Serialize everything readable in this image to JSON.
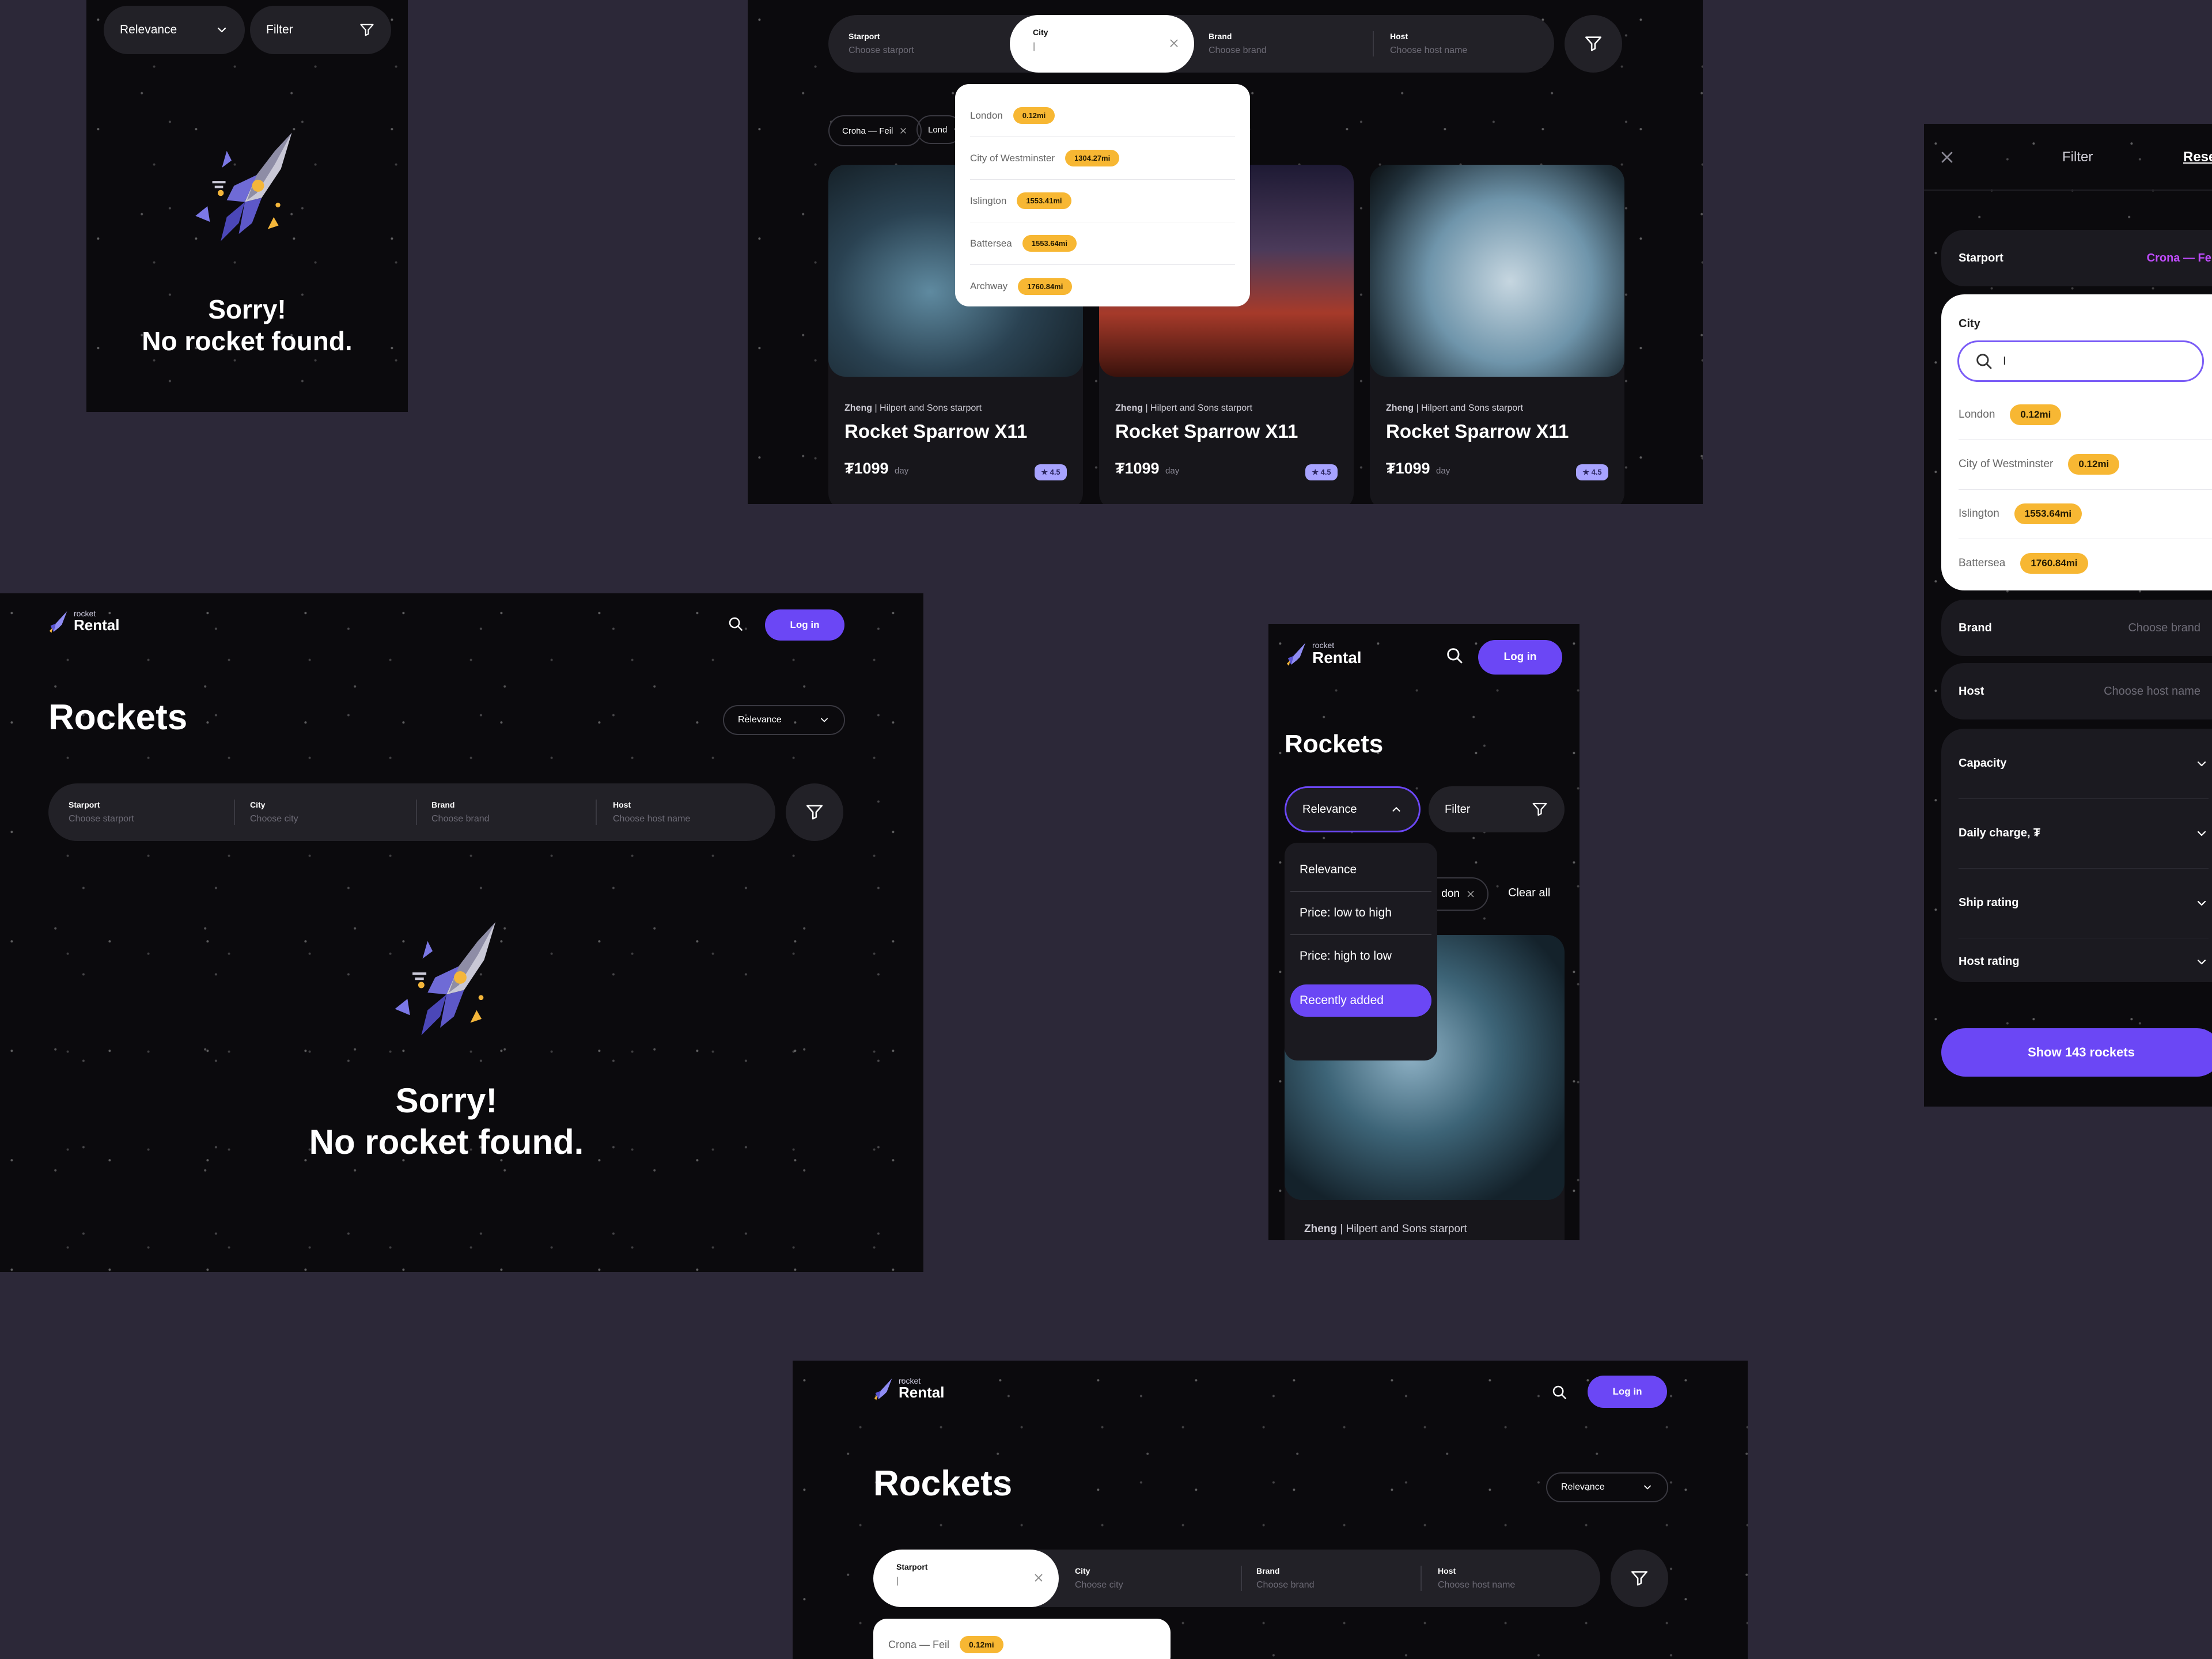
{
  "brand": {
    "small": "rocket",
    "big": "Rental"
  },
  "nav": {
    "login_label": "Log in"
  },
  "page": {
    "title": "Rockets"
  },
  "sort": {
    "selected": "Relevance",
    "options": [
      "Relevance",
      "Price: low to high",
      "Price: high to low",
      "Recently added"
    ],
    "active_option": "Recently added"
  },
  "filter_button": {
    "label": "Filter"
  },
  "search": {
    "starport_label": "Starport",
    "starport_placeholder": "Choose starport",
    "city_label": "City",
    "city_placeholder": "Choose city",
    "city_value": "|",
    "brand_label": "Brand",
    "brand_placeholder": "Choose brand",
    "host_label": "Host",
    "host_placeholder": "Choose host name"
  },
  "empty_state": {
    "line1": "Sorry!",
    "line2": "No rocket found."
  },
  "chips": {
    "starport": "Crona — Feil",
    "city_partial": "Lond",
    "city_partial2": "don",
    "clear_all": "Clear all"
  },
  "city_results_a": [
    {
      "name": "London",
      "distance": "0.12mi"
    },
    {
      "name": "City of Westminster",
      "distance": "1304.27mi"
    },
    {
      "name": "Islington",
      "distance": "1553.41mi"
    },
    {
      "name": "Battersea",
      "distance": "1553.64mi"
    },
    {
      "name": "Archway",
      "distance": "1760.84mi"
    }
  ],
  "city_results_b": [
    {
      "name": "London",
      "distance": "0.12mi"
    },
    {
      "name": "City of Westminster",
      "distance": "0.12mi"
    },
    {
      "name": "Islington",
      "distance": "1553.64mi"
    },
    {
      "name": "Battersea",
      "distance": "1760.84mi"
    }
  ],
  "starport_result": {
    "name": "Crona — Feil",
    "distance": "0.12mi"
  },
  "listing": {
    "brand": "Zheng",
    "host": " | Hilpert and Sons starport",
    "name": "Rocket Sparrow X11",
    "price": "₮1099",
    "unit": "day",
    "rating": "★ 4.5"
  },
  "filter_panel": {
    "title": "Filter",
    "reset": "Reset",
    "starport_label": "Starport",
    "starport_value": "Crona — Feil",
    "city_label": "City",
    "search_value": "I",
    "brand_label": "Brand",
    "brand_placeholder": "Choose brand",
    "host_label": "Host",
    "host_placeholder": "Choose host name",
    "sections": [
      "Capacity",
      "Daily charge, ₮",
      "Ship rating",
      "Host rating"
    ],
    "show_button": "Show 143 rockets"
  },
  "colors": {
    "accent": "#6b47f5",
    "tag": "#f7b733",
    "background": "#2c2838",
    "screen": "#0b0a0d",
    "panel": "#222127"
  }
}
